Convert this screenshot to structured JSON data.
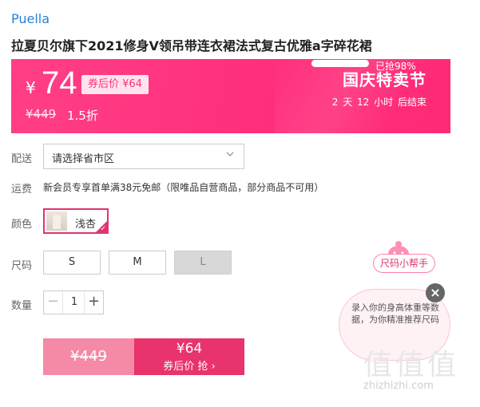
{
  "brand": "Puella",
  "title": "拉夏贝尔旗下2021修身V领吊带连衣裙法式复古优雅a字碎花裙",
  "promo": {
    "currency": "¥",
    "price": "74",
    "coupon_price": "券后价 ¥64",
    "original_price": "¥449",
    "discount": "1.5折",
    "festival": "国庆特卖节",
    "countdown": [
      "2",
      "天",
      "12",
      "小时",
      "后结束"
    ],
    "sold_percent_value": 98,
    "sold_text": "已抢98%"
  },
  "delivery": {
    "label": "配送",
    "placeholder": "请选择省市区"
  },
  "shipping": {
    "label": "运费",
    "text": "新会员专享首单满38元免邮（限唯品自营商品，部分商品不可用）"
  },
  "color": {
    "label": "颜色",
    "option": "浅杏"
  },
  "size": {
    "label": "尺码",
    "options": [
      "S",
      "M",
      "L"
    ]
  },
  "quantity": {
    "label": "数量",
    "value": "1",
    "minus": "−",
    "plus": "+"
  },
  "buy": {
    "original": "¥449",
    "price": "¥64",
    "action": "券后价 抢 ›"
  },
  "size_helper": {
    "tag": "尺码小帮手",
    "message": "录入你的身高体重等数据，为你精准推荐尺码",
    "close": "×"
  },
  "watermark": {
    "glyphs": "值值值",
    "url": "zhizhizhi.com"
  },
  "colors": {
    "accent": "#e8336c",
    "promo_bg": "#ff2f7e",
    "brand_link": "#2a7fd6"
  }
}
